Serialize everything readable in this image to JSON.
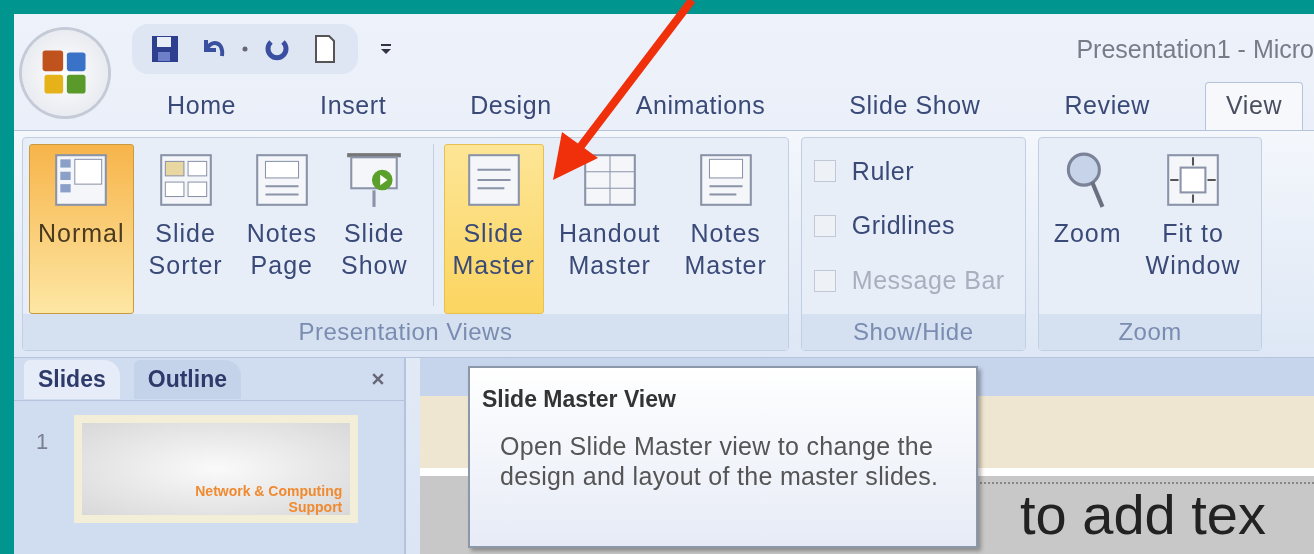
{
  "window": {
    "title": "Presentation1 - Micro"
  },
  "tabs": [
    {
      "label": "Home",
      "selected": false
    },
    {
      "label": "Insert",
      "selected": false
    },
    {
      "label": "Design",
      "selected": false
    },
    {
      "label": "Animations",
      "selected": false
    },
    {
      "label": "Slide Show",
      "selected": false
    },
    {
      "label": "Review",
      "selected": false
    },
    {
      "label": "View",
      "selected": true
    }
  ],
  "ribbon": {
    "groups": [
      {
        "kind": "buttons",
        "label": "Presentation Views",
        "sections": [
          [
            {
              "label": "Normal",
              "selected": true,
              "highlighted": false
            },
            {
              "label": "Slide Sorter",
              "selected": false,
              "highlighted": false
            },
            {
              "label": "Notes Page",
              "selected": false,
              "highlighted": false
            },
            {
              "label": "Slide Show",
              "selected": false,
              "highlighted": false
            }
          ],
          [
            {
              "label": "Slide Master",
              "selected": false,
              "highlighted": true
            },
            {
              "label": "Handout Master",
              "selected": false,
              "highlighted": false
            },
            {
              "label": "Notes Master",
              "selected": false,
              "highlighted": false
            }
          ]
        ]
      },
      {
        "kind": "checks",
        "label": "Show/Hide",
        "items": [
          {
            "label": "Ruler",
            "checked": false,
            "disabled": false
          },
          {
            "label": "Gridlines",
            "checked": false,
            "disabled": false
          },
          {
            "label": "Message Bar",
            "checked": false,
            "disabled": true
          }
        ]
      },
      {
        "kind": "buttons",
        "label": "Zoom",
        "sections": [
          [
            {
              "label": "Zoom",
              "selected": false,
              "highlighted": false
            },
            {
              "label": "Fit to Window",
              "selected": false,
              "highlighted": false
            }
          ]
        ]
      }
    ]
  },
  "pane": {
    "tabs": [
      {
        "label": "Slides",
        "selected": true
      },
      {
        "label": "Outline",
        "selected": false
      }
    ],
    "slides": [
      {
        "number": "1",
        "title": "Network & Computing",
        "subtitle": "Support"
      }
    ]
  },
  "tooltip": {
    "title": "Slide Master View",
    "text": "Open Slide Master view to change the design and layout of the master slides."
  },
  "slide": {
    "body_text": "to add tex"
  }
}
